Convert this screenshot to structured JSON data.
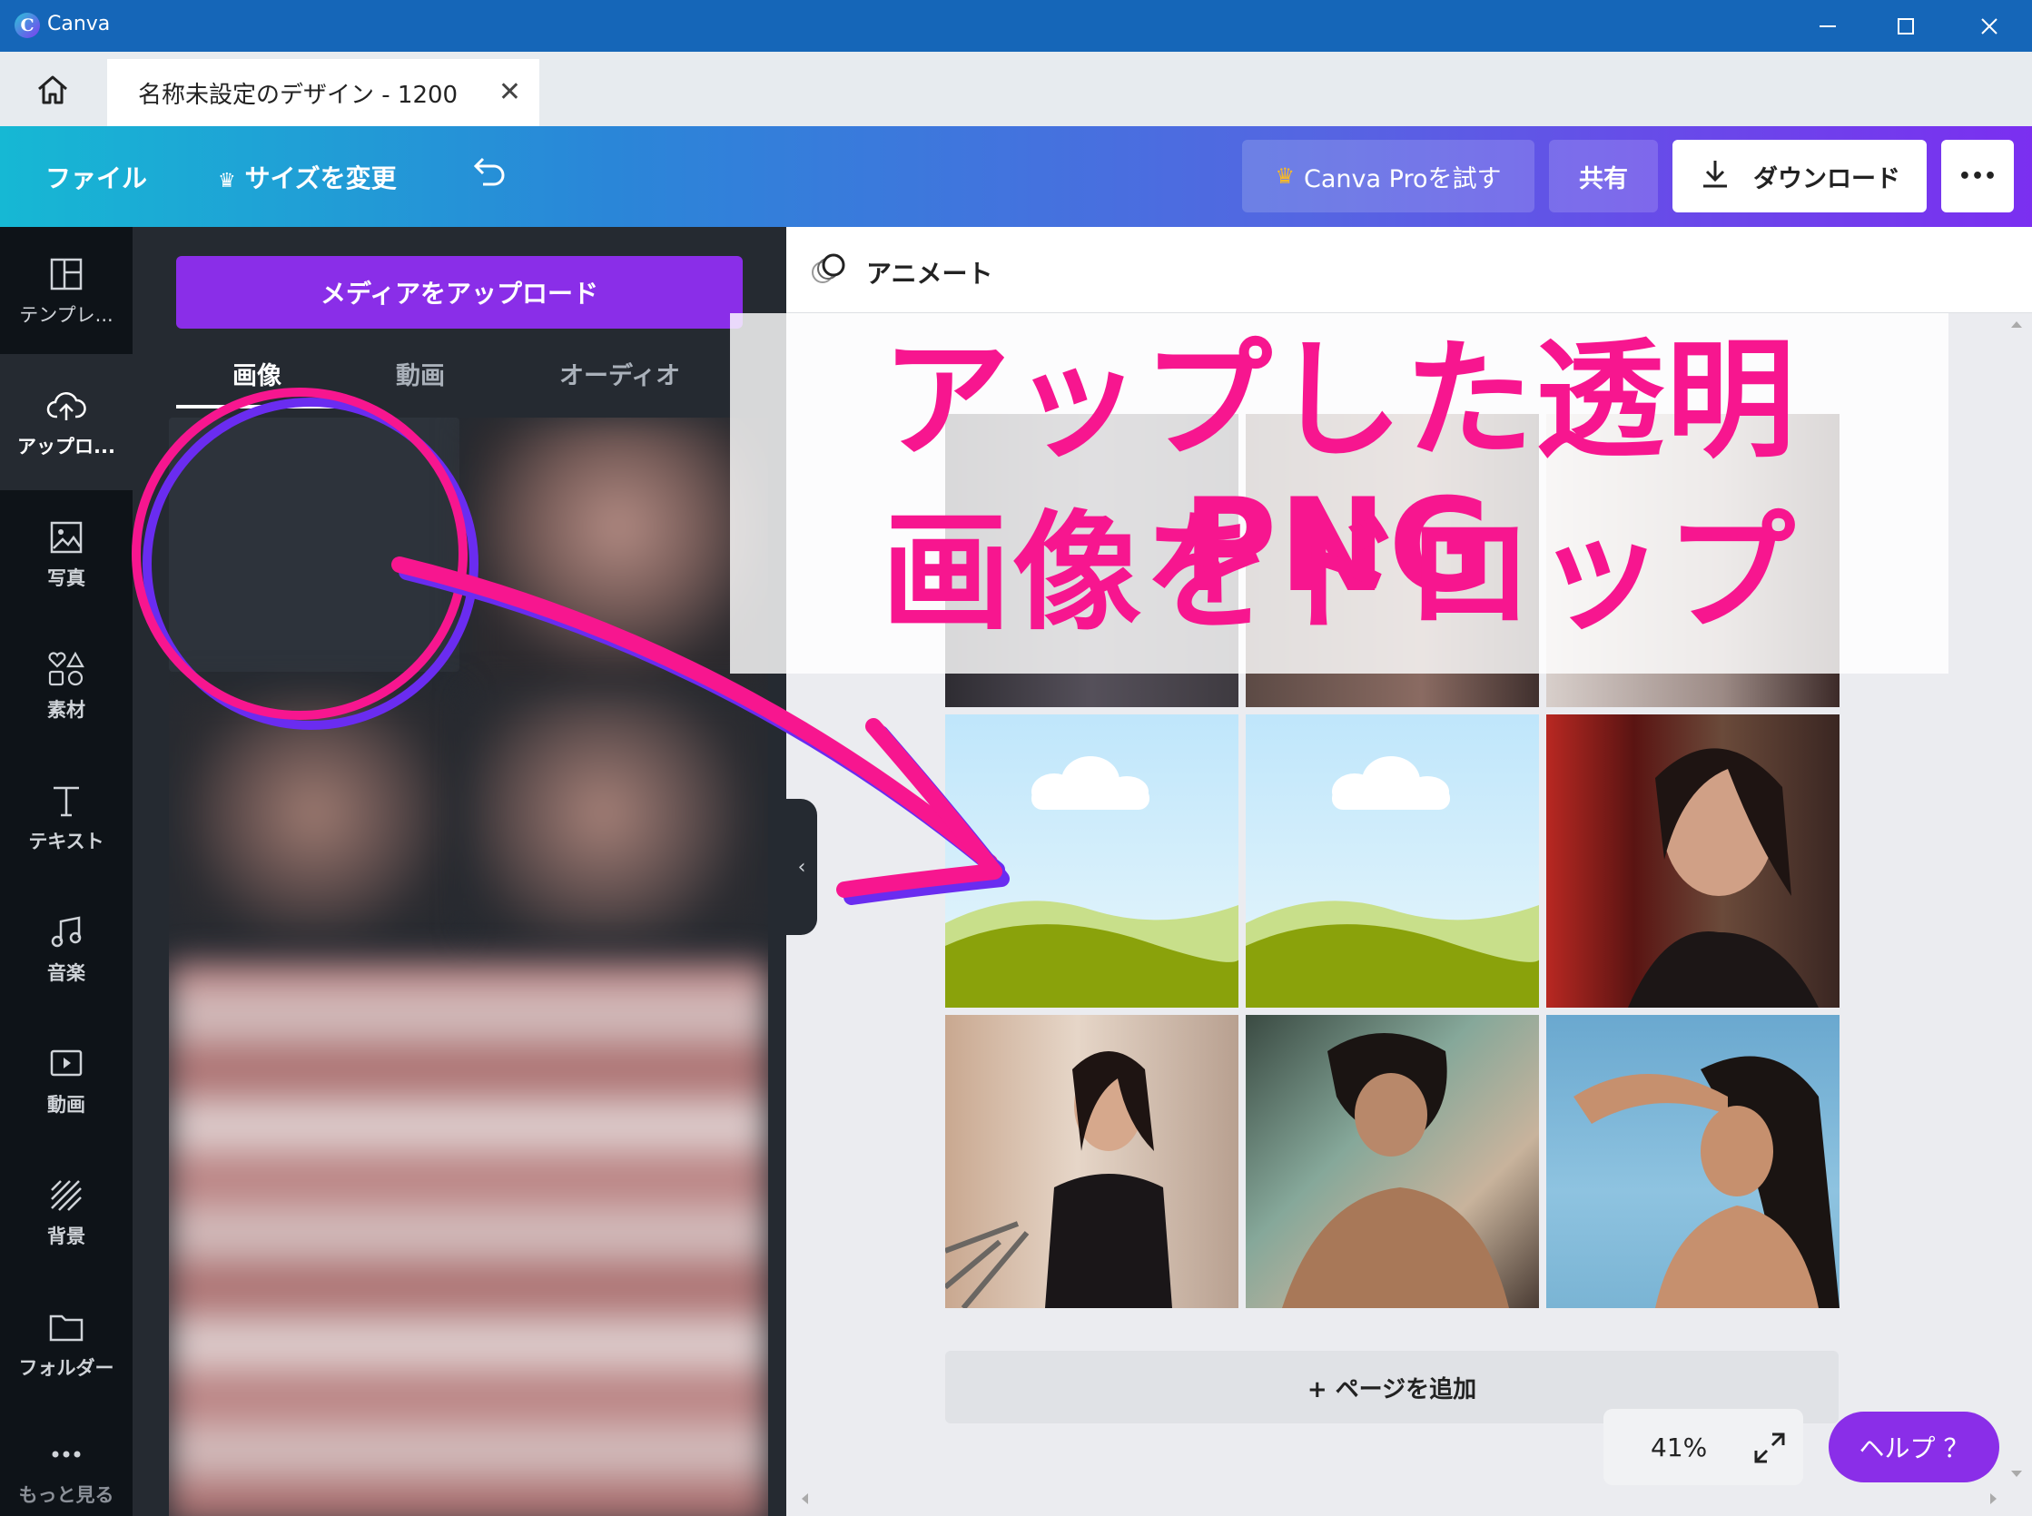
{
  "window": {
    "app_title": "Canva"
  },
  "tabs": {
    "doc_title": "名称未設定のデザイン - 1200"
  },
  "toolbar": {
    "file": "ファイル",
    "resize": "サイズを変更",
    "try_pro": "Canva Proを試す",
    "share": "共有",
    "download": "ダウンロード",
    "more": "•••"
  },
  "rail": {
    "items": [
      {
        "label": "テンプレ...",
        "icon": "template-icon"
      },
      {
        "label": "アップロ...",
        "icon": "upload-cloud-icon"
      },
      {
        "label": "写真",
        "icon": "photo-icon"
      },
      {
        "label": "素材",
        "icon": "elements-icon"
      },
      {
        "label": "テキスト",
        "icon": "text-icon"
      },
      {
        "label": "音楽",
        "icon": "music-icon"
      },
      {
        "label": "動画",
        "icon": "video-icon"
      },
      {
        "label": "背景",
        "icon": "background-icon"
      },
      {
        "label": "フォルダー",
        "icon": "folder-icon"
      },
      {
        "label": "もっと見る",
        "icon": "more-icon"
      }
    ]
  },
  "panel": {
    "upload_button": "メディアをアップロード",
    "tabs": [
      "画像",
      "動画",
      "オーディオ"
    ],
    "active_tab": 0
  },
  "canvas": {
    "animate": "アニメート",
    "add_page": "+ ページを追加",
    "zoom": "41%",
    "help": "ヘルプ ？"
  },
  "annotation": {
    "line1": "アップした透明PNG",
    "line2": "画像をドロップ",
    "color": "#f7168f"
  },
  "colors": {
    "toolbar_start": "#16b8d4",
    "toolbar_end": "#7b2ff0",
    "accent_purple": "#8a2ee8",
    "rail_bg": "#0e1318",
    "panel_bg": "#252a31"
  }
}
